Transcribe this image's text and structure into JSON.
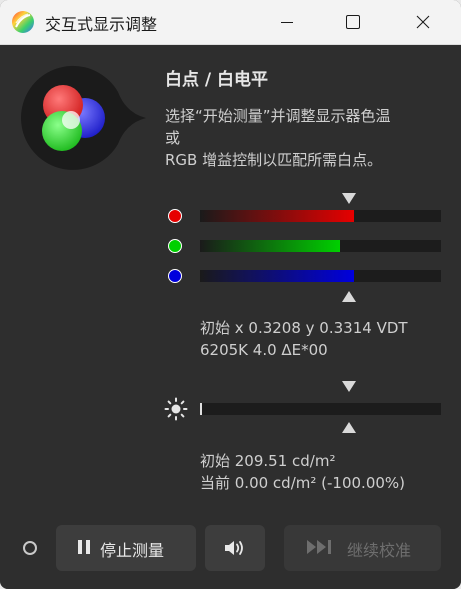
{
  "window": {
    "title": "交互式显示调整"
  },
  "panel": {
    "heading": "白点 / 白电平",
    "description_lines": [
      "选择“开始测量”并调整显示器色温",
      "或",
      "RGB 增益控制以匹配所需白点。"
    ]
  },
  "rgb_gain": {
    "channels": [
      {
        "name": "red",
        "color": "#e60000",
        "level": 0.64
      },
      {
        "name": "green",
        "color": "#00d000",
        "level": 0.58
      },
      {
        "name": "blue",
        "color": "#0000dd",
        "level": 0.64
      }
    ],
    "target_marker_level": 0.62,
    "readout_lines": [
      "初始 x 0.3208 y 0.3314 VDT",
      "6205K 4.0 ΔE*00"
    ]
  },
  "luminance": {
    "level": 0.0,
    "target_marker_level": 0.62,
    "readout_lines": [
      "初始 209.51 cd/m²",
      "当前 0.00 cd/m² (-100.00%)"
    ]
  },
  "toolbar": {
    "stop_label": "停止测量",
    "continue_label": "继续校准",
    "sound_icon": "speaker-icon"
  },
  "colors": {
    "window_bg": "#2e2e2e",
    "button_bg": "#3d3d3d",
    "track_bg": "#1c1c1c",
    "disabled_text": "#6e6e6e"
  }
}
